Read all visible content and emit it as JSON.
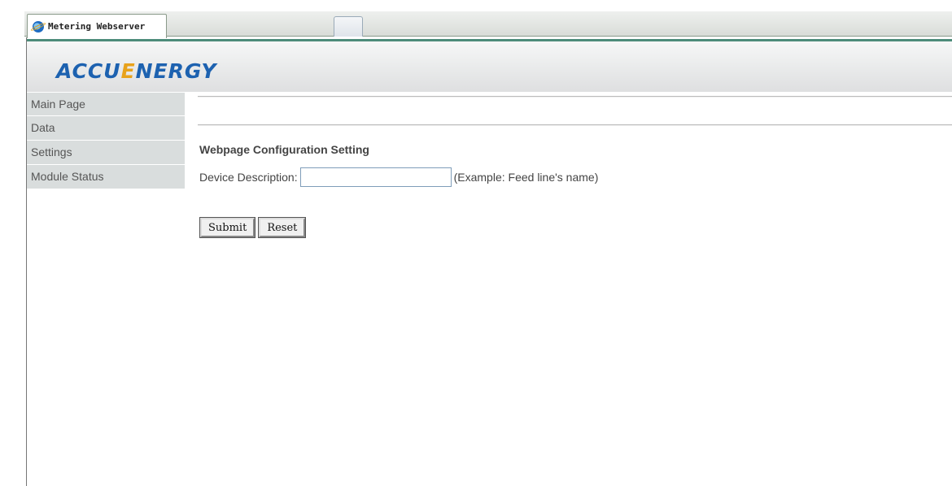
{
  "browser": {
    "tab_title": "Metering Webserver"
  },
  "header": {
    "logo_text_part1": "ACCU",
    "logo_text_accent": "E",
    "logo_text_part2": "NERGY"
  },
  "sidebar": {
    "items": [
      {
        "label": "Main Page"
      },
      {
        "label": "Data"
      },
      {
        "label": "Settings"
      },
      {
        "label": "Module Status"
      }
    ]
  },
  "main": {
    "section_title": "Webpage Configuration Setting",
    "device_description_label": "Device Description:",
    "device_description_value": "",
    "device_description_hint": "(Example: Feed line's name)",
    "submit_label": "Submit",
    "reset_label": "Reset"
  },
  "colors": {
    "logo_blue": "#1d62b0",
    "logo_orange": "#e8a21b",
    "sidebar_bg": "#d9dddd",
    "header_accent": "#4d8c7a"
  }
}
